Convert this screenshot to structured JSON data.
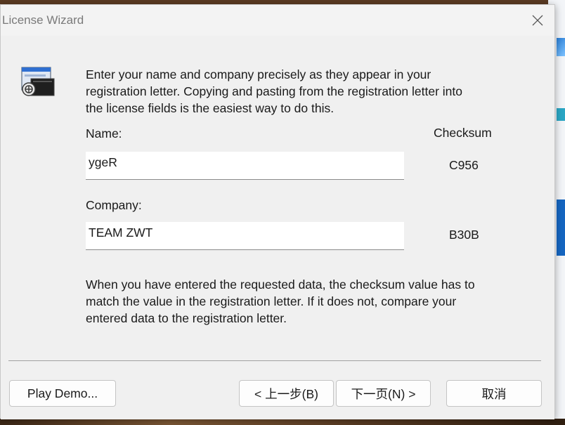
{
  "window": {
    "title": "License Wizard"
  },
  "intro_text": "Enter your name and company precisely as they appear in your\nregistration letter.  Copying and pasting from the registration letter into\nthe license fields is the easiest way to do this.",
  "fields": {
    "checksum_header": "Checksum",
    "name": {
      "label": "Name:",
      "value": "ygeR",
      "checksum": "C956"
    },
    "company": {
      "label": "Company:",
      "value": "TEAM ZWT",
      "checksum": "B30B"
    }
  },
  "outro_text": "When you have entered the requested data, the checksum value has to\nmatch the value in the registration letter.  If it does not, compare your\nentered data to the registration letter.",
  "buttons": {
    "play_demo": "Play Demo...",
    "back": "< 上一步(B)",
    "next": "下一页(N) >",
    "cancel": "取消"
  },
  "icons": {
    "app": "license-key-icon",
    "close": "close-icon"
  }
}
